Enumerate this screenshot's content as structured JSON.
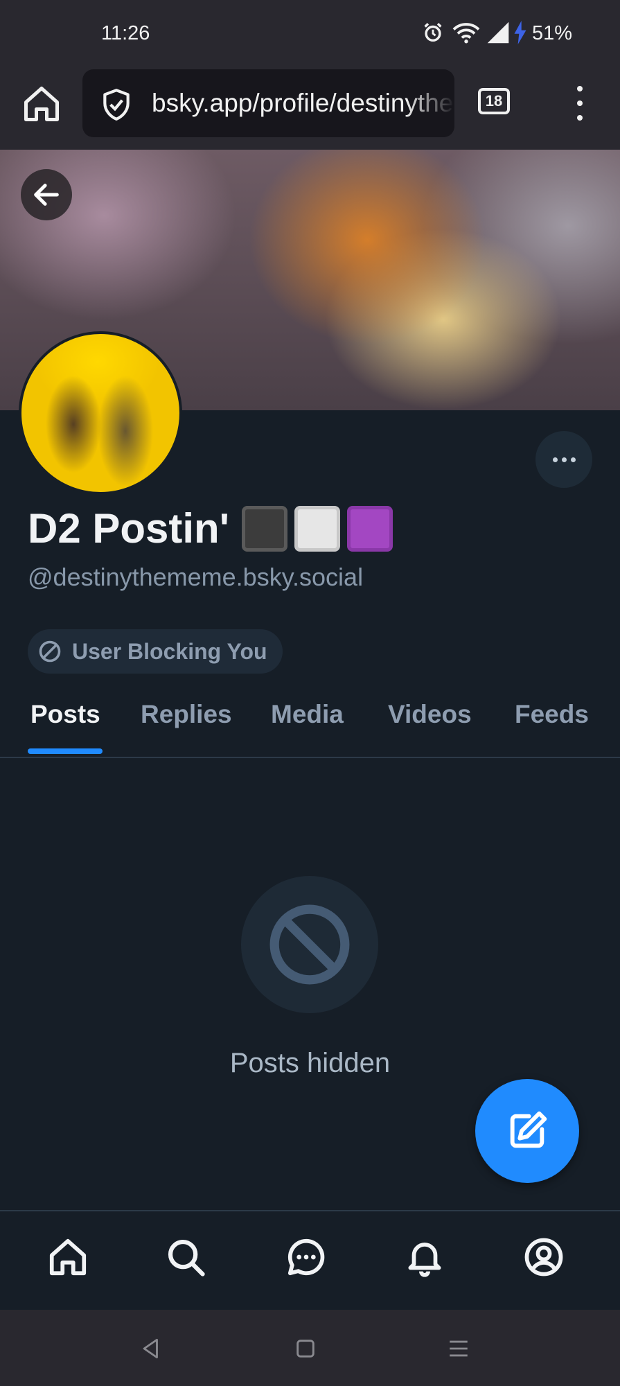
{
  "status_bar": {
    "time": "11:26",
    "battery": "51%"
  },
  "browser": {
    "url": "bsky.app/profile/destinythememe.bsky.social",
    "tab_count": "18"
  },
  "profile": {
    "display_name": "D2 Postin'",
    "handle": "@destinythememe.bsky.social",
    "blocking_label": "User Blocking You"
  },
  "tabs": [
    {
      "label": "Posts"
    },
    {
      "label": "Replies"
    },
    {
      "label": "Media"
    },
    {
      "label": "Videos"
    },
    {
      "label": "Feeds"
    }
  ],
  "content": {
    "hidden_label": "Posts hidden"
  },
  "colors": {
    "accent": "#208bfe",
    "background": "#161e27",
    "muted_text": "#8e9db0"
  },
  "icons": {
    "browser": [
      "home-icon",
      "shield-check-icon",
      "tab-counter-icon",
      "more-vertical-icon"
    ],
    "profile": [
      "back-arrow-icon",
      "more-horizontal-icon",
      "block-icon"
    ],
    "fab": "compose-icon",
    "bottom_nav": [
      "home-icon",
      "search-icon",
      "chat-icon",
      "bell-icon",
      "profile-icon"
    ],
    "system_nav": [
      "back-triangle-icon",
      "home-square-icon",
      "recents-lines-icon"
    ]
  }
}
